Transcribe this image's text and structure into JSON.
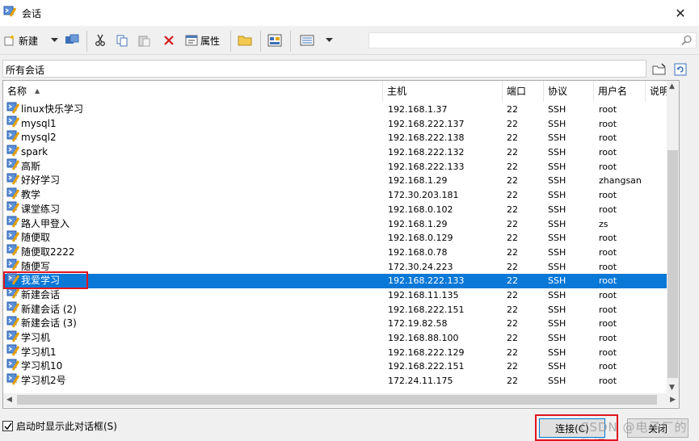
{
  "window": {
    "title": "会话"
  },
  "toolbar": {
    "new_label": "新建",
    "properties_label": "属性"
  },
  "path": {
    "text": "所有会话"
  },
  "columns": [
    "名称",
    "主机",
    "端口",
    "协议",
    "用户名",
    "说明"
  ],
  "sessions": [
    {
      "name": "linux快乐学习",
      "host": "192.168.1.37",
      "port": "22",
      "protocol": "SSH",
      "user": "root"
    },
    {
      "name": "mysql1",
      "host": "192.168.222.137",
      "port": "22",
      "protocol": "SSH",
      "user": "root"
    },
    {
      "name": "mysql2",
      "host": "192.168.222.138",
      "port": "22",
      "protocol": "SSH",
      "user": "root"
    },
    {
      "name": "spark",
      "host": "192.168.222.132",
      "port": "22",
      "protocol": "SSH",
      "user": "root"
    },
    {
      "name": "高斯",
      "host": "192.168.222.133",
      "port": "22",
      "protocol": "SSH",
      "user": "root"
    },
    {
      "name": "好好学习",
      "host": "192.168.1.29",
      "port": "22",
      "protocol": "SSH",
      "user": "zhangsan"
    },
    {
      "name": "教学",
      "host": "172.30.203.181",
      "port": "22",
      "protocol": "SSH",
      "user": "root"
    },
    {
      "name": "课堂练习",
      "host": "192.168.0.102",
      "port": "22",
      "protocol": "SSH",
      "user": "root"
    },
    {
      "name": "路人甲登入",
      "host": "192.168.1.29",
      "port": "22",
      "protocol": "SSH",
      "user": "zs"
    },
    {
      "name": "随便取",
      "host": "192.168.0.129",
      "port": "22",
      "protocol": "SSH",
      "user": "root"
    },
    {
      "name": "随便取2222",
      "host": "192.168.0.78",
      "port": "22",
      "protocol": "SSH",
      "user": "root"
    },
    {
      "name": "随便写",
      "host": "172.30.24.223",
      "port": "22",
      "protocol": "SSH",
      "user": "root"
    },
    {
      "name": "我爱学习",
      "host": "192.168.222.133",
      "port": "22",
      "protocol": "SSH",
      "user": "root",
      "selected": true
    },
    {
      "name": "新建会话",
      "host": "192.168.11.135",
      "port": "22",
      "protocol": "SSH",
      "user": "root"
    },
    {
      "name": "新建会话 (2)",
      "host": "192.168.222.151",
      "port": "22",
      "protocol": "SSH",
      "user": "root"
    },
    {
      "name": "新建会话 (3)",
      "host": "172.19.82.58",
      "port": "22",
      "protocol": "SSH",
      "user": "root"
    },
    {
      "name": "学习机",
      "host": "192.168.88.100",
      "port": "22",
      "protocol": "SSH",
      "user": "root"
    },
    {
      "name": "学习机1",
      "host": "192.168.222.129",
      "port": "22",
      "protocol": "SSH",
      "user": "root"
    },
    {
      "name": "学习机10",
      "host": "192.168.222.151",
      "port": "22",
      "protocol": "SSH",
      "user": "root"
    },
    {
      "name": "学习机2号",
      "host": "172.24.11.175",
      "port": "22",
      "protocol": "SSH",
      "user": "root"
    }
  ],
  "footer": {
    "show_on_startup_label": "启动时显示此对话框(S)",
    "show_on_startup_checked": true,
    "connect_label": "连接(C)",
    "close_label": "关闭"
  },
  "watermark": "CSDN @电子厂的数据",
  "colors": {
    "selection": "#0a78d7",
    "highlight_box": "#e0141e",
    "default_button_border": "#0078d7"
  },
  "icons": [
    "session-icon",
    "new-session-icon",
    "dropdown-icon",
    "session-manager-icon",
    "cut-icon",
    "copy-icon",
    "paste-icon",
    "delete-icon",
    "properties-icon",
    "folder-icon",
    "tab-icon",
    "view-icon",
    "search-icon",
    "close-icon",
    "open-folder-icon",
    "refresh-icon"
  ]
}
